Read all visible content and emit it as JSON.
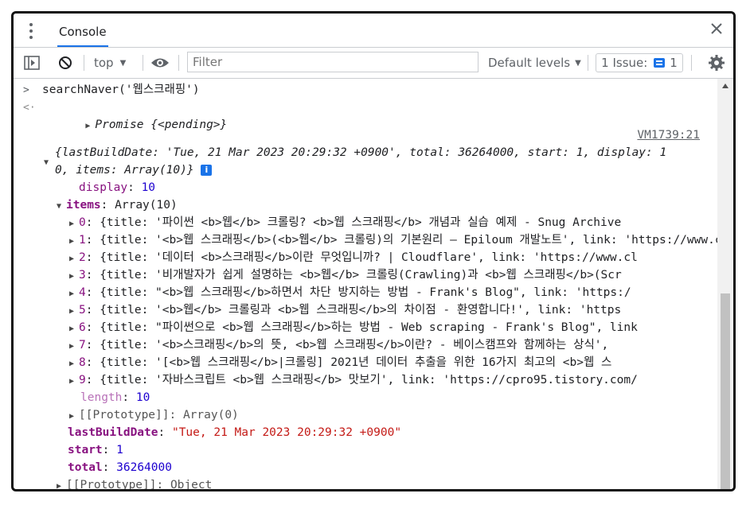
{
  "tab": {
    "label": "Console"
  },
  "toolbar": {
    "context": "top",
    "filter_placeholder": "Filter",
    "levels": "Default levels",
    "issues_label": "1 Issue:",
    "issues_count": "1"
  },
  "log": {
    "input_cmd": "searchNaver('웹스크래핑')",
    "result_promise": "Promise {<pending>}",
    "source_link": "VM1739:21",
    "summary_line1": "{lastBuildDate: 'Tue, 21 Mar 2023 20:29:32 +0900', total: 36264000, start: 1, display: 1",
    "summary_line2": "0, items: Array(10)}",
    "display_key": "display",
    "display_val": "10",
    "items_key": "items",
    "items_val": "Array(10)",
    "items": [
      {
        "idx": "0",
        "text": "{title: '파이썬 <b>웹</b> 크롤링? <b>웹 스크래핑</b> 개념과 실습 예제 - Snug Archive"
      },
      {
        "idx": "1",
        "text": "{title: '<b>웹 스크래핑</b>(<b>웹</b> 크롤링)의 기본원리 – Epiloum 개발노트', link: 'https://www.cl"
      },
      {
        "idx": "2",
        "text": "{title: '데이터 <b>스크래핑</b>이란 무엇입니까? | Cloudflare', link: 'https://www.cl"
      },
      {
        "idx": "3",
        "text": "{title: '비개발자가 쉽게 설명하는 <b>웹</b> 크롤링(Crawling)과 <b>웹 스크래핑</b>(Scr"
      },
      {
        "idx": "4",
        "text": "{title: \"<b>웹 스크래핑</b>하면서 차단 방지하는 방법 - Frank's Blog\", link: 'https:/"
      },
      {
        "idx": "5",
        "text": "{title: '<b>웹</b> 크롤링과 <b>웹 스크래핑</b>의 차이점 - 환영합니다!', link: 'https"
      },
      {
        "idx": "6",
        "text": "{title: \"파이썬으로 <b>웹 스크래핑</b>하는 방법 - Web scraping - Frank's Blog\", link"
      },
      {
        "idx": "7",
        "text": "{title: '<b>스크래핑</b>의 뜻, <b>웹 스크래핑</b>이란? - 베이스캠프와 함께하는 상식',"
      },
      {
        "idx": "8",
        "text": "{title: '[<b>웹 스크래핑</b>|크롤링] 2021년 데이터 추출을 위한 16가지 최고의 <b>웹 스"
      },
      {
        "idx": "9",
        "text": "{title: '자바스크립트 <b>웹 스크래핑</b> 맛보기', link: 'https://cpro95.tistory.com/"
      }
    ],
    "length_key": "length",
    "length_val": "10",
    "proto_items": "[[Prototype]]: Array(0)",
    "lbd_key": "lastBuildDate",
    "lbd_val": "\"Tue, 21 Mar 2023 20:29:32 +0900\"",
    "start_key": "start",
    "start_val": "1",
    "total_key": "total",
    "total_val": "36264000",
    "proto_obj": "[[Prototype]]: Object"
  }
}
